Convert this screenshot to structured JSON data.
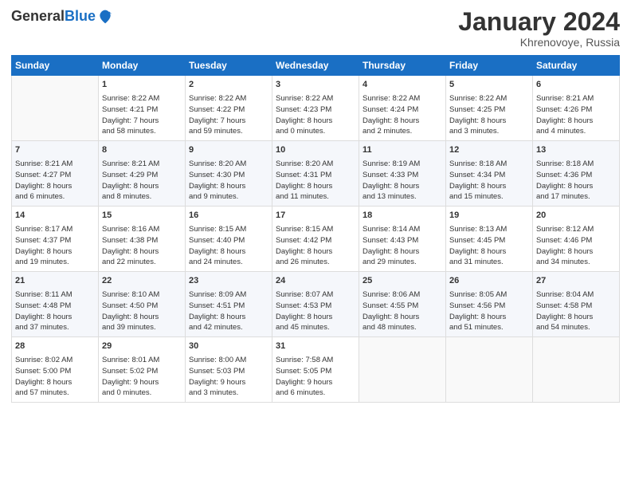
{
  "logo": {
    "general": "General",
    "blue": "Blue"
  },
  "header": {
    "month": "January 2024",
    "location": "Khrenovoye, Russia"
  },
  "days_of_week": [
    "Sunday",
    "Monday",
    "Tuesday",
    "Wednesday",
    "Thursday",
    "Friday",
    "Saturday"
  ],
  "weeks": [
    [
      {
        "day": "",
        "info": ""
      },
      {
        "day": "1",
        "info": "Sunrise: 8:22 AM\nSunset: 4:21 PM\nDaylight: 7 hours\nand 58 minutes."
      },
      {
        "day": "2",
        "info": "Sunrise: 8:22 AM\nSunset: 4:22 PM\nDaylight: 7 hours\nand 59 minutes."
      },
      {
        "day": "3",
        "info": "Sunrise: 8:22 AM\nSunset: 4:23 PM\nDaylight: 8 hours\nand 0 minutes."
      },
      {
        "day": "4",
        "info": "Sunrise: 8:22 AM\nSunset: 4:24 PM\nDaylight: 8 hours\nand 2 minutes."
      },
      {
        "day": "5",
        "info": "Sunrise: 8:22 AM\nSunset: 4:25 PM\nDaylight: 8 hours\nand 3 minutes."
      },
      {
        "day": "6",
        "info": "Sunrise: 8:21 AM\nSunset: 4:26 PM\nDaylight: 8 hours\nand 4 minutes."
      }
    ],
    [
      {
        "day": "7",
        "info": "Sunrise: 8:21 AM\nSunset: 4:27 PM\nDaylight: 8 hours\nand 6 minutes."
      },
      {
        "day": "8",
        "info": "Sunrise: 8:21 AM\nSunset: 4:29 PM\nDaylight: 8 hours\nand 8 minutes."
      },
      {
        "day": "9",
        "info": "Sunrise: 8:20 AM\nSunset: 4:30 PM\nDaylight: 8 hours\nand 9 minutes."
      },
      {
        "day": "10",
        "info": "Sunrise: 8:20 AM\nSunset: 4:31 PM\nDaylight: 8 hours\nand 11 minutes."
      },
      {
        "day": "11",
        "info": "Sunrise: 8:19 AM\nSunset: 4:33 PM\nDaylight: 8 hours\nand 13 minutes."
      },
      {
        "day": "12",
        "info": "Sunrise: 8:18 AM\nSunset: 4:34 PM\nDaylight: 8 hours\nand 15 minutes."
      },
      {
        "day": "13",
        "info": "Sunrise: 8:18 AM\nSunset: 4:36 PM\nDaylight: 8 hours\nand 17 minutes."
      }
    ],
    [
      {
        "day": "14",
        "info": "Sunrise: 8:17 AM\nSunset: 4:37 PM\nDaylight: 8 hours\nand 19 minutes."
      },
      {
        "day": "15",
        "info": "Sunrise: 8:16 AM\nSunset: 4:38 PM\nDaylight: 8 hours\nand 22 minutes."
      },
      {
        "day": "16",
        "info": "Sunrise: 8:15 AM\nSunset: 4:40 PM\nDaylight: 8 hours\nand 24 minutes."
      },
      {
        "day": "17",
        "info": "Sunrise: 8:15 AM\nSunset: 4:42 PM\nDaylight: 8 hours\nand 26 minutes."
      },
      {
        "day": "18",
        "info": "Sunrise: 8:14 AM\nSunset: 4:43 PM\nDaylight: 8 hours\nand 29 minutes."
      },
      {
        "day": "19",
        "info": "Sunrise: 8:13 AM\nSunset: 4:45 PM\nDaylight: 8 hours\nand 31 minutes."
      },
      {
        "day": "20",
        "info": "Sunrise: 8:12 AM\nSunset: 4:46 PM\nDaylight: 8 hours\nand 34 minutes."
      }
    ],
    [
      {
        "day": "21",
        "info": "Sunrise: 8:11 AM\nSunset: 4:48 PM\nDaylight: 8 hours\nand 37 minutes."
      },
      {
        "day": "22",
        "info": "Sunrise: 8:10 AM\nSunset: 4:50 PM\nDaylight: 8 hours\nand 39 minutes."
      },
      {
        "day": "23",
        "info": "Sunrise: 8:09 AM\nSunset: 4:51 PM\nDaylight: 8 hours\nand 42 minutes."
      },
      {
        "day": "24",
        "info": "Sunrise: 8:07 AM\nSunset: 4:53 PM\nDaylight: 8 hours\nand 45 minutes."
      },
      {
        "day": "25",
        "info": "Sunrise: 8:06 AM\nSunset: 4:55 PM\nDaylight: 8 hours\nand 48 minutes."
      },
      {
        "day": "26",
        "info": "Sunrise: 8:05 AM\nSunset: 4:56 PM\nDaylight: 8 hours\nand 51 minutes."
      },
      {
        "day": "27",
        "info": "Sunrise: 8:04 AM\nSunset: 4:58 PM\nDaylight: 8 hours\nand 54 minutes."
      }
    ],
    [
      {
        "day": "28",
        "info": "Sunrise: 8:02 AM\nSunset: 5:00 PM\nDaylight: 8 hours\nand 57 minutes."
      },
      {
        "day": "29",
        "info": "Sunrise: 8:01 AM\nSunset: 5:02 PM\nDaylight: 9 hours\nand 0 minutes."
      },
      {
        "day": "30",
        "info": "Sunrise: 8:00 AM\nSunset: 5:03 PM\nDaylight: 9 hours\nand 3 minutes."
      },
      {
        "day": "31",
        "info": "Sunrise: 7:58 AM\nSunset: 5:05 PM\nDaylight: 9 hours\nand 6 minutes."
      },
      {
        "day": "",
        "info": ""
      },
      {
        "day": "",
        "info": ""
      },
      {
        "day": "",
        "info": ""
      }
    ]
  ]
}
